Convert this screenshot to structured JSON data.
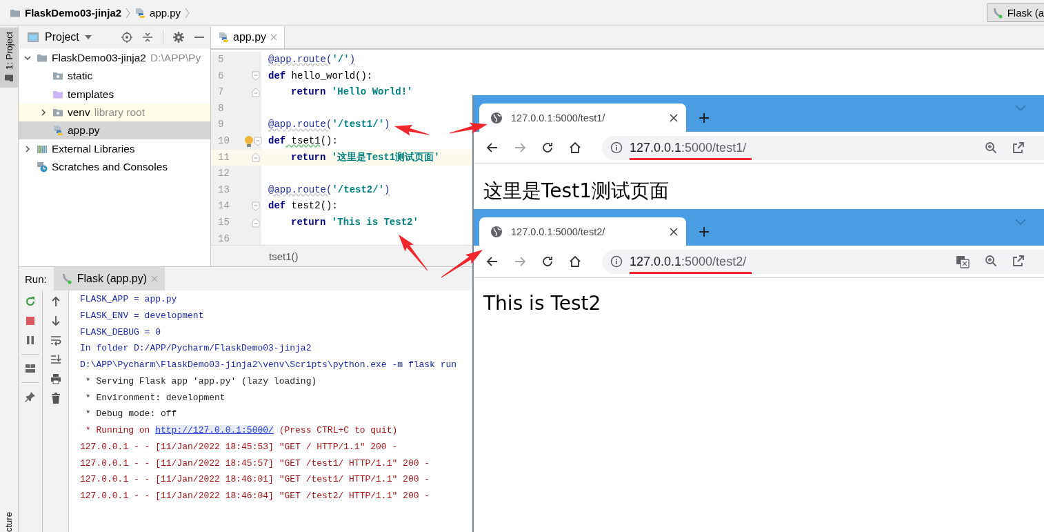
{
  "breadcrumb": [
    {
      "label": "FlaskDemo03-jinja2",
      "kind": "folder"
    },
    {
      "label": "app.py",
      "kind": "python-file"
    }
  ],
  "run_config": {
    "label": "Flask (a"
  },
  "tool_strip": {
    "tabs": [
      {
        "label": "1: Project",
        "selected": true
      }
    ],
    "bottom_label": "cture"
  },
  "project": {
    "title": "Project",
    "tree": [
      {
        "label": "FlaskDemo03-jinja2",
        "note": "D:\\APP\\Py",
        "kind": "project-folder",
        "expanded": true,
        "selected": false,
        "highlighted": false,
        "children": [
          {
            "label": "static",
            "kind": "resource-folder",
            "selected": false,
            "highlighted": false
          },
          {
            "label": "templates",
            "kind": "template-folder",
            "selected": false,
            "highlighted": false
          },
          {
            "label": "venv",
            "note": "library root",
            "kind": "library-folder",
            "expanded": false,
            "selected": false,
            "highlighted": true
          },
          {
            "label": "app.py",
            "kind": "python-file",
            "selected": true,
            "highlighted": false
          }
        ]
      },
      {
        "label": "External Libraries",
        "kind": "libraries",
        "expanded": false,
        "selected": false,
        "highlighted": false
      },
      {
        "label": "Scratches and Consoles",
        "kind": "scratches",
        "selected": false,
        "highlighted": false
      }
    ]
  },
  "editor": {
    "tabs": [
      {
        "label": "app.py",
        "selected": true
      }
    ],
    "lines": [
      {
        "number": "5",
        "current": false,
        "indented": false,
        "fold_start": false,
        "fold_end": false,
        "bulb": false,
        "tokens": [
          {
            "kind": "decorator",
            "text": "@app.route("
          },
          {
            "kind": "string",
            "text": "'/'"
          },
          {
            "kind": "decorator",
            "text": ")"
          }
        ]
      },
      {
        "number": "6",
        "current": false,
        "indented": false,
        "fold_start": true,
        "fold_end": false,
        "bulb": false,
        "tokens": [
          {
            "kind": "keyword",
            "text": "def"
          },
          {
            "kind": "plain",
            "text": " hello_world():"
          }
        ]
      },
      {
        "number": "7",
        "current": false,
        "indented": true,
        "fold_start": false,
        "fold_end": true,
        "bulb": false,
        "tokens": [
          {
            "kind": "keyword",
            "text": "return"
          },
          {
            "kind": "string",
            "text": " 'Hello World!'"
          }
        ]
      },
      {
        "number": "8",
        "current": false,
        "fold_start": false,
        "fold_end": false,
        "bulb": false
      },
      {
        "number": "9",
        "current": false,
        "indented": false,
        "fold_start": false,
        "fold_end": false,
        "bulb": false,
        "tokens": [
          {
            "kind": "decorator",
            "text": "@app.route("
          },
          {
            "kind": "string",
            "text": "'/test1/'"
          },
          {
            "kind": "decorator",
            "text": ")"
          }
        ]
      },
      {
        "number": "10",
        "current": false,
        "indented": false,
        "fold_start": true,
        "fold_end": false,
        "bulb": true,
        "tokens": [
          {
            "kind": "keyword",
            "text": "def"
          },
          {
            "kind": "typo",
            "text": " tset1"
          },
          {
            "kind": "plain",
            "text": "():"
          }
        ]
      },
      {
        "number": "11",
        "current": true,
        "indented": true,
        "fold_start": false,
        "fold_end": true,
        "bulb": false,
        "tokens": [
          {
            "kind": "keyword",
            "text": "return"
          },
          {
            "kind": "string",
            "text": " '这里是Test1测试页面'"
          }
        ]
      },
      {
        "number": "12",
        "current": false,
        "fold_start": false,
        "fold_end": false,
        "bulb": false
      },
      {
        "number": "13",
        "current": false,
        "indented": false,
        "fold_start": false,
        "fold_end": false,
        "bulb": false,
        "tokens": [
          {
            "kind": "decorator",
            "text": "@app.route("
          },
          {
            "kind": "string",
            "text": "'/test2/'"
          },
          {
            "kind": "decorator",
            "text": ")"
          }
        ]
      },
      {
        "number": "14",
        "current": false,
        "indented": false,
        "fold_start": true,
        "fold_end": false,
        "bulb": false,
        "tokens": [
          {
            "kind": "keyword",
            "text": "def"
          },
          {
            "kind": "plain",
            "text": " test2():"
          }
        ]
      },
      {
        "number": "15",
        "current": false,
        "indented": true,
        "fold_start": false,
        "fold_end": true,
        "bulb": false,
        "tokens": [
          {
            "kind": "keyword",
            "text": "return"
          },
          {
            "kind": "string",
            "text": " 'This is Test2'"
          }
        ]
      },
      {
        "number": "16",
        "current": false,
        "fold_start": false,
        "fold_end": false,
        "bulb": false
      }
    ],
    "breadcrumb": "tset1()"
  },
  "run": {
    "label": "Run:",
    "tabs": [
      {
        "label": "Flask (app.py)",
        "selected": true
      }
    ],
    "console": [
      {
        "kind": "info",
        "text": "FLASK_APP = app.py"
      },
      {
        "kind": "info",
        "text": "FLASK_ENV = development"
      },
      {
        "kind": "info",
        "text": "FLASK_DEBUG = 0"
      },
      {
        "kind": "info",
        "text": "In folder D:/APP/Pycharm/FlaskDemo03-jinja2"
      },
      {
        "kind": "info",
        "text": "D:\\APP\\Pycharm\\FlaskDemo03-jinja2\\venv\\Scripts\\python.exe -m flask run"
      },
      {
        "kind": "output",
        "text": " * Serving Flask app 'app.py' (lazy loading)"
      },
      {
        "kind": "output",
        "text": " * Environment: development"
      },
      {
        "kind": "output",
        "text": " * Debug mode: off"
      },
      {
        "kind": "error",
        "text": " * Running on ",
        "link": "http://127.0.0.1:5000/",
        "after": " (Press CTRL+C to quit)"
      },
      {
        "kind": "error",
        "text": "127.0.0.1 - - [11/Jan/2022 18:45:53] \"GET / HTTP/1.1\" 200 -"
      },
      {
        "kind": "error",
        "text": "127.0.0.1 - - [11/Jan/2022 18:45:57] \"GET /test1/ HTTP/1.1\" 200 -"
      },
      {
        "kind": "error",
        "text": "127.0.0.1 - - [11/Jan/2022 18:46:01] \"GET /test1/ HTTP/1.1\" 200 -"
      },
      {
        "kind": "error",
        "text": "127.0.0.1 - - [11/Jan/2022 18:46:04] \"GET /test2/ HTTP/1.1\" 200 -"
      }
    ]
  },
  "browsers": [
    {
      "tab": "127.0.0.1:5000/test1/",
      "url_host": "127.0.0.1",
      "url_path": ":5000/test1/",
      "translate": false,
      "heading": "这里是Test1测试页面"
    },
    {
      "tab": "127.0.0.1:5000/test2/",
      "url_host": "127.0.0.1",
      "url_path": ":5000/test2/",
      "translate": true,
      "heading": "This is Test2"
    }
  ]
}
